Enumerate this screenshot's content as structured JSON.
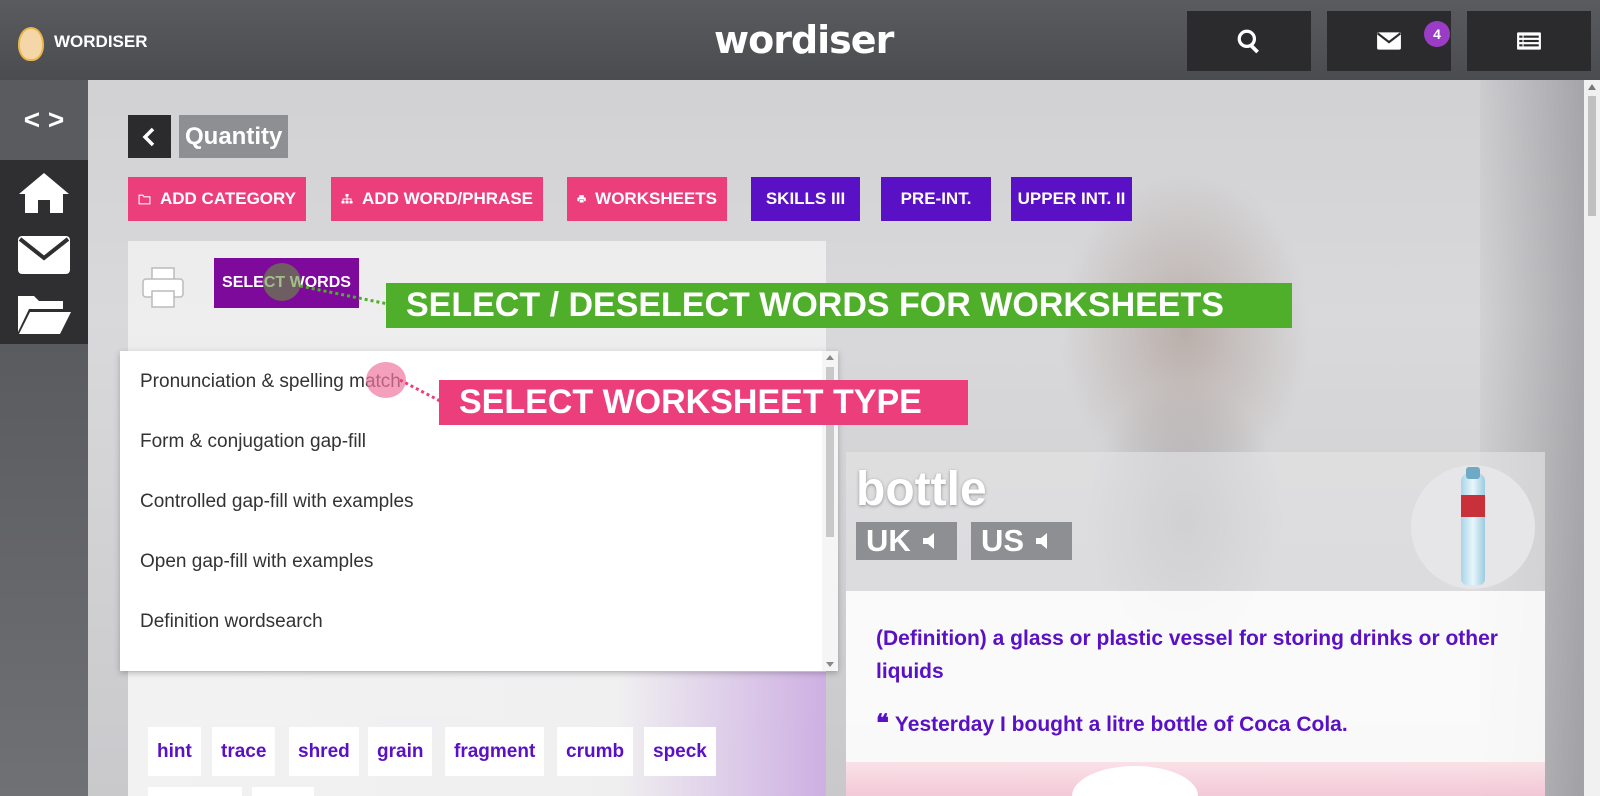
{
  "header": {
    "brand": "WORDISER",
    "logo": "wordiser",
    "search_icon": "search-icon",
    "mail_icon": "mail-icon",
    "mail_badge": "4",
    "menu_icon": "list-icon"
  },
  "sidebar": {
    "toggle": "< >",
    "items": [
      "home-icon",
      "mail-icon",
      "folder-icon"
    ]
  },
  "page": {
    "title": "Quantity",
    "actions": [
      {
        "label": "ADD CATEGORY",
        "icon": "folder-icon",
        "color": "#ec3e7b"
      },
      {
        "label": "ADD WORD/PHRASE",
        "icon": "sitemap-icon",
        "color": "#ec3e7b"
      },
      {
        "label": "WORKSHEETS",
        "icon": "printer-icon",
        "color": "#ec3e7b"
      },
      {
        "label": "SKILLS III",
        "color": "#5a10c4"
      },
      {
        "label": "PRE-INT.",
        "color": "#5a10c4"
      },
      {
        "label": "UPPER INT. II",
        "color": "#5a10c4"
      }
    ]
  },
  "worksheet": {
    "select_words": "SELECT WORDS",
    "banner_select": "SELECT / DESELECT WORDS FOR WORKSHEETS",
    "banner_type": "SELECT WORKSHEET TYPE",
    "types": [
      "Pronunciation & spelling match",
      "Form & conjugation gap-fill",
      "Controlled gap-fill with examples",
      "Open gap-fill with examples",
      "Definition wordsearch"
    ]
  },
  "words": [
    "hint",
    "trace",
    "shred",
    "grain",
    "fragment",
    "crumb",
    "speck"
  ],
  "word_card": {
    "word": "bottle",
    "uk": "UK",
    "us": "US",
    "definition": "(Definition) a glass or plastic vessel for storing drinks or other liquids",
    "example": "Yesterday I bought a litre bottle of Coca Cola."
  },
  "colors": {
    "pink": "#ec3e7b",
    "purple": "#5a10c4",
    "green": "#4fae2a",
    "dark": "#2b2b2d"
  }
}
